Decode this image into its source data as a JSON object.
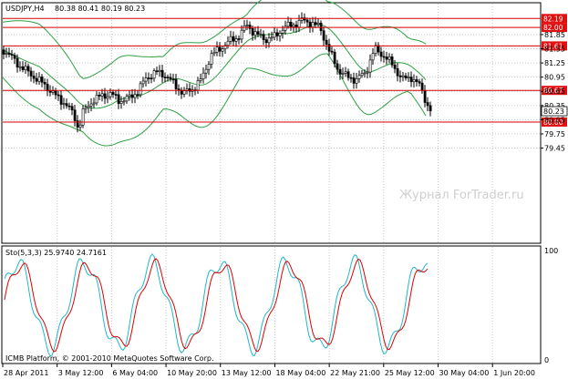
{
  "main_chart": {
    "symbol": "USDJPY,H4",
    "ohlc": "80.38 80.41 80.19 80.23",
    "watermark": "Журнал ForTrader.ru",
    "y_ticks": [
      "81.85",
      "81.55",
      "81.25",
      "80.95",
      "80.65",
      "80.35",
      "80.05",
      "79.75",
      "79.45"
    ],
    "current_price": "80.23",
    "levels": [
      {
        "label": "82.19",
        "value": 82.19
      },
      {
        "label": "82.00",
        "value": 82.0
      },
      {
        "label": "81.61",
        "value": 81.61
      },
      {
        "label": "80.67",
        "value": 80.67
      },
      {
        "label": "80.00",
        "value": 80.0
      }
    ]
  },
  "stoch_panel": {
    "label": "Sto(5,3,3) 25.9740 24.7161",
    "scale_top": "100",
    "scale_bottom": "0"
  },
  "x_axis": {
    "labels": [
      "28 Apr 2011",
      "3 May 12:00",
      "6 May 04:00",
      "10 May 20:00",
      "13 May 12:00",
      "18 May 04:00",
      "22 May 21:00",
      "25 May 12:00",
      "30 May 04:00",
      "1 Jun 20:00"
    ]
  },
  "footer": "ICMB Platform, © 2001-2010 MetaQuotes Software Corp.",
  "colors": {
    "grid": "#c8c8c8",
    "level": "#d40000",
    "level_box": "#e01010",
    "bands": "#2ea043",
    "candle": "#000000",
    "stoch_main": "#e00000",
    "stoch_signal": "#20b6c8"
  }
}
